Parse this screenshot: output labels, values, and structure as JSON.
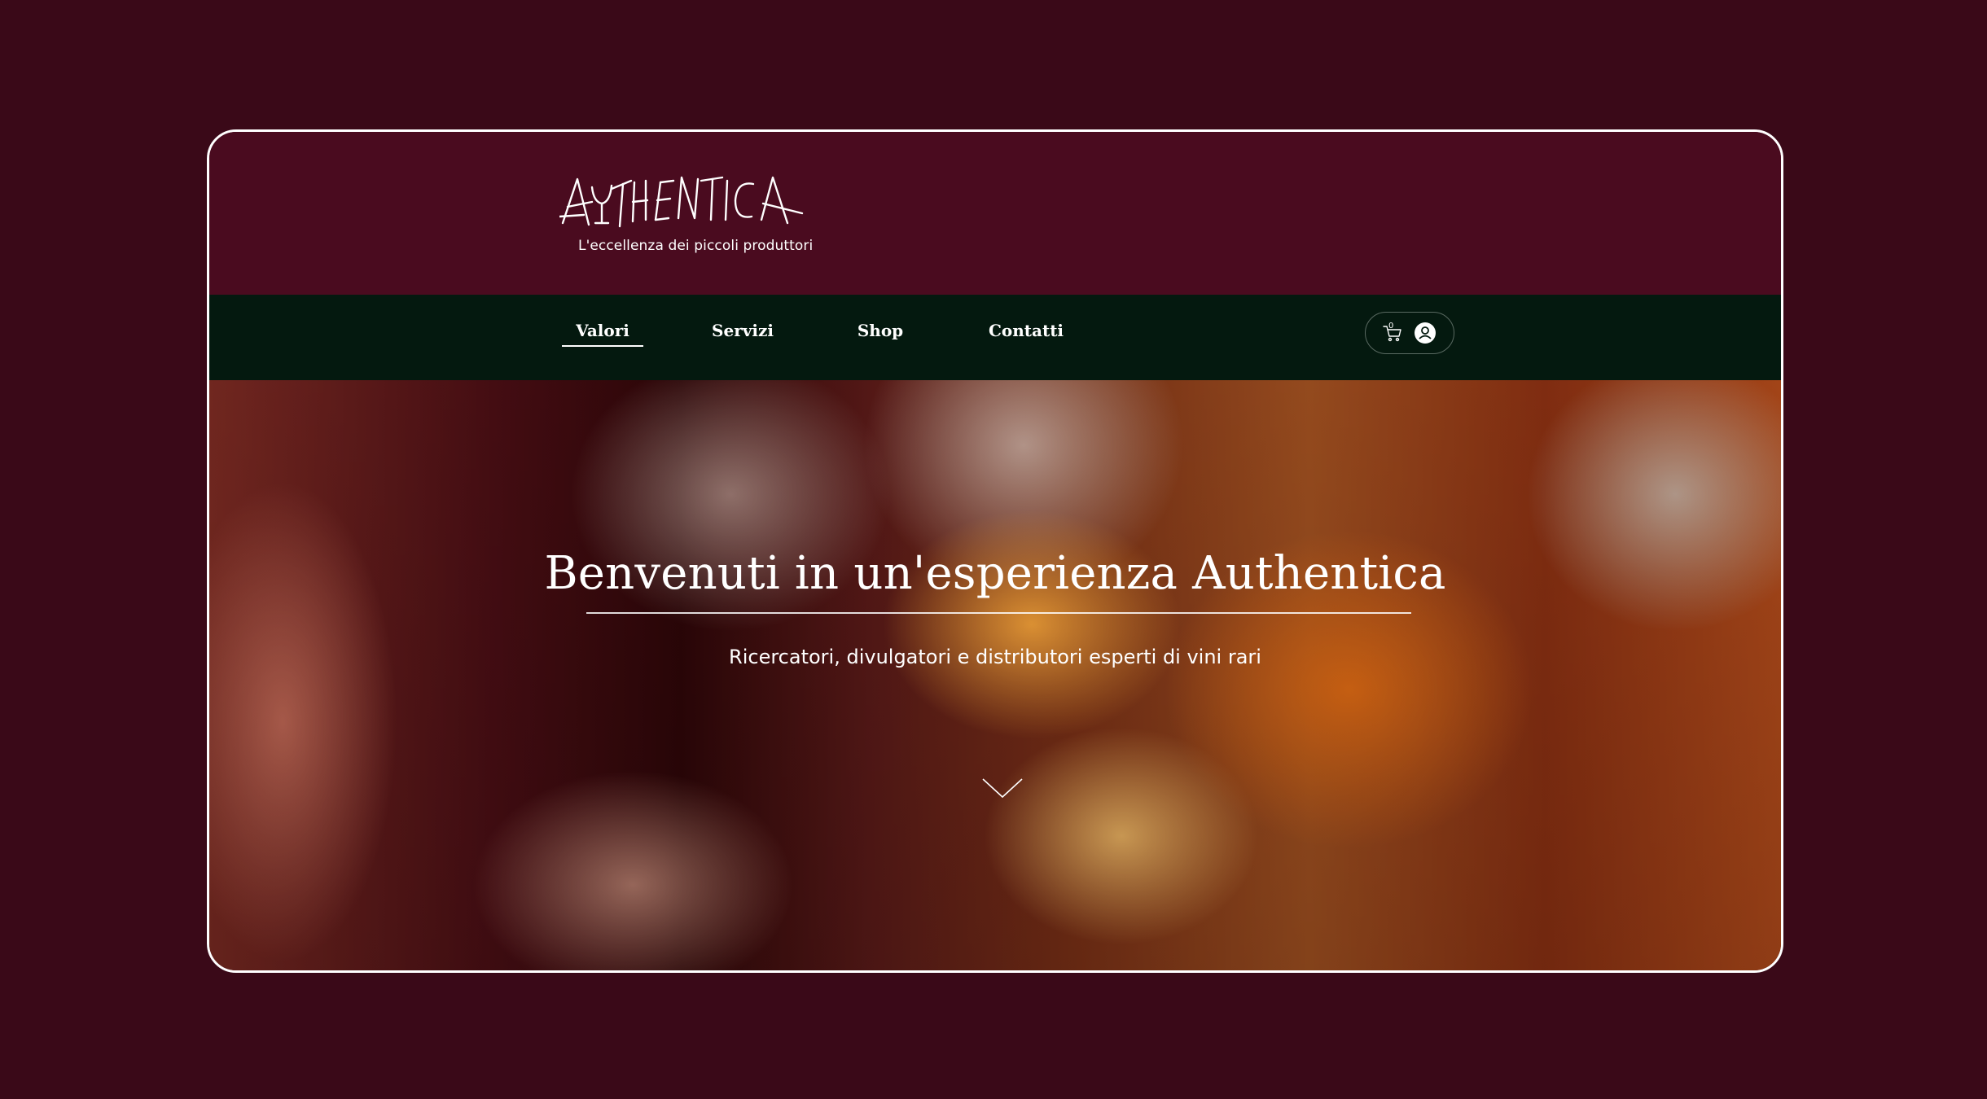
{
  "brand": {
    "logo_text": "AUTHENTICA",
    "tagline": "L'eccellenza dei piccoli produttori"
  },
  "nav": {
    "items": [
      {
        "label": "Valori",
        "active": true
      },
      {
        "label": "Servizi",
        "active": false
      },
      {
        "label": "Shop",
        "active": false
      },
      {
        "label": "Contatti",
        "active": false
      }
    ],
    "cart_count": "0",
    "cart_icon": "cart-icon",
    "account_icon": "user-icon"
  },
  "hero": {
    "title": "Benvenuti in un'esperienza Authentica",
    "subtitle": "Ricercatori, divulgatori e distributori esperti di vini rari",
    "scroll_icon": "chevron-down-icon"
  },
  "colors": {
    "page_background": "#3a0918",
    "header_background": "#4a0b1f",
    "nav_background": "#04190f",
    "text": "#ffffff"
  }
}
